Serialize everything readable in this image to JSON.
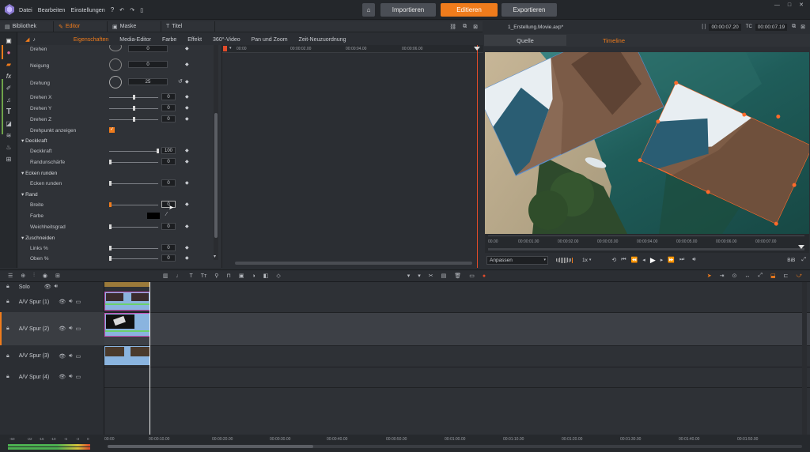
{
  "menu": [
    "Datei",
    "Bearbeiten",
    "Einstellungen"
  ],
  "main_tabs": {
    "import": "Importieren",
    "edit": "Editieren",
    "export": "Exportieren"
  },
  "lib_tabs": {
    "library": "Bibliothek",
    "editor": "Editor",
    "mask": "Maske",
    "title": "Titel"
  },
  "sub_tabs": [
    "Eigenschaften",
    "Media-Editor",
    "Farbe",
    "Effekt",
    "360°-Video",
    "Pan und Zoom",
    "Zeit-Neuzuordnung"
  ],
  "props": {
    "drehen": {
      "label": "Drehen",
      "value": "0"
    },
    "neigung": {
      "label": "Neigung",
      "value": "0"
    },
    "drehung": {
      "label": "Drehung",
      "value": "25"
    },
    "drehen_x": {
      "label": "Drehen X",
      "value": "0"
    },
    "drehen_y": {
      "label": "Drehen Y",
      "value": "0"
    },
    "drehen_z": {
      "label": "Drehen Z",
      "value": "0"
    },
    "drehpunkt": {
      "label": "Drehpunkt anzeigen"
    },
    "deckkraft_section": "Deckkraft",
    "deckkraft": {
      "label": "Deckkraft",
      "value": "100"
    },
    "randunschaerfe": {
      "label": "Randunschärfe",
      "value": "0"
    },
    "ecken_section": "Ecken runden",
    "ecken": {
      "label": "Ecken runden",
      "value": "0"
    },
    "rand_section": "Rand",
    "breite": {
      "label": "Breite",
      "value": "0"
    },
    "farbe": {
      "label": "Farbe"
    },
    "weichheit": {
      "label": "Weichheitsgrad",
      "value": "0"
    },
    "zuschneiden_section": "Zuschneiden",
    "links": {
      "label": "Links %",
      "value": "0"
    },
    "oben": {
      "label": "Oben %",
      "value": "0"
    }
  },
  "keyframe_ruler": [
    "00:00",
    "00:00:02.00",
    "00:00:04.00",
    "00:00:06.00"
  ],
  "preview": {
    "filename": "1_Erstellung.Movie.axp*",
    "timecode": "00:00:07.20",
    "tc_label": "TC",
    "duration": "00:00:07.19",
    "tab_source": "Quelle",
    "tab_timeline": "Timeline",
    "ruler": [
      "00.00",
      "00:00:01.00",
      "00:00:02.00",
      "00:00:03.00",
      "00:00:04.00",
      "00:00:05.00",
      "00:00:06.00",
      "00:00:07.00"
    ],
    "fit": "Anpassen",
    "speed": "1x",
    "bib": "BiB"
  },
  "tracks": {
    "solo": "Solo",
    "items": [
      "A/V Spur (1)",
      "A/V Spur (2)",
      "A/V Spur (3)",
      "A/V Spur (4)"
    ]
  },
  "timeline_ruler": [
    "00:00",
    "00:00:10.00",
    "00:00:20.00",
    "00:00:30.00",
    "00:00:40.00",
    "00:00:50.00",
    "00:01:00.00",
    "00:01:10.00",
    "00:01:20.00",
    "00:01:30.00",
    "00:01:40.00",
    "00:01:50.00"
  ],
  "meter_scale": [
    "-60",
    "-22",
    "-16",
    "-10",
    "-6",
    "-3",
    "0"
  ],
  "colors": {
    "accent": "#f07c1c",
    "active_tab": "#f07c1c",
    "selection": "#ff6a2a",
    "track_clip": "#8ab4df"
  }
}
